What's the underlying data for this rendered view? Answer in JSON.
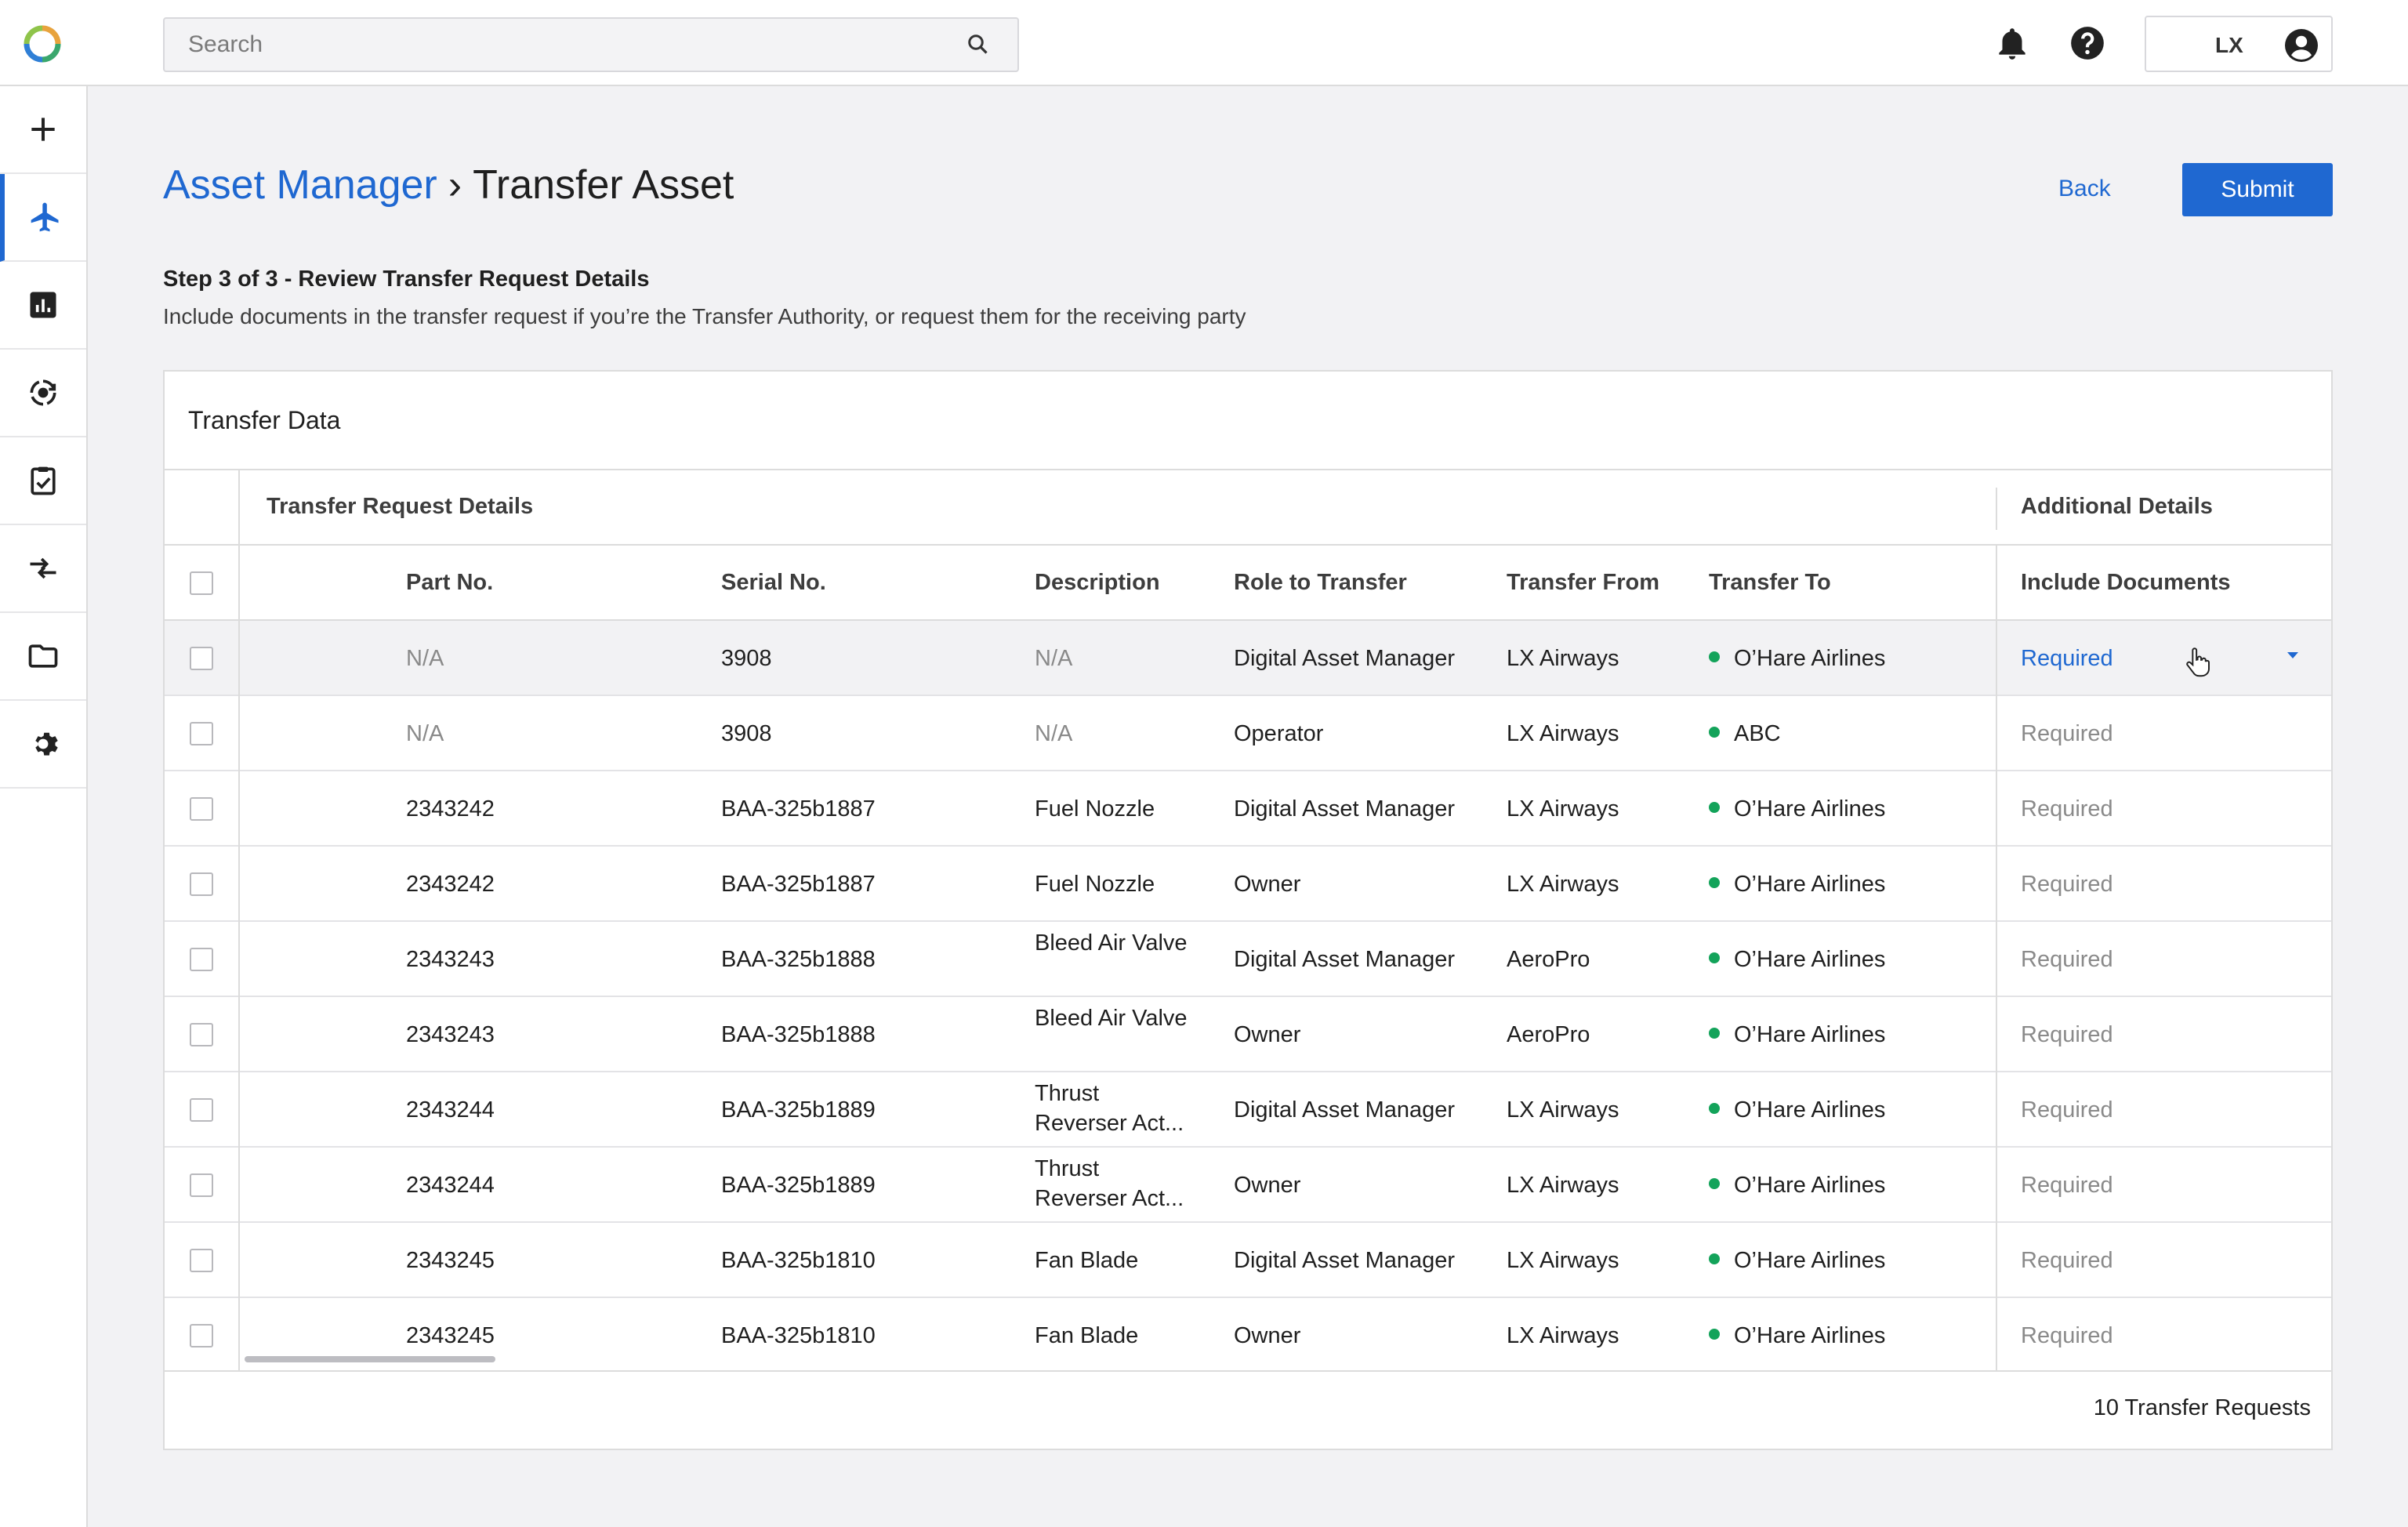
{
  "topbar": {
    "search_placeholder": "Search",
    "icons": [
      "app-logo-icon",
      "search-icon",
      "bell-icon",
      "help-icon",
      "account-icon"
    ],
    "user_initials": "LX"
  },
  "sidebar": {
    "items": [
      {
        "icon": "plus-icon",
        "active": false
      },
      {
        "icon": "airplane-icon",
        "active": true
      },
      {
        "icon": "bar-chart-icon",
        "active": false
      },
      {
        "icon": "sync-icon",
        "active": false
      },
      {
        "icon": "clipboard-check-icon",
        "active": false
      },
      {
        "icon": "transfer-arrows-icon",
        "active": false
      },
      {
        "icon": "folder-icon",
        "active": false
      },
      {
        "icon": "gear-icon",
        "active": false
      }
    ]
  },
  "header": {
    "breadcrumb_parent": "Asset Manager",
    "breadcrumb_sep": "›",
    "breadcrumb_current": "Transfer Asset",
    "back_label": "Back",
    "submit_label": "Submit",
    "step_title": "Step 3 of 3 - Review Transfer Request Details",
    "step_desc": "Include documents in the transfer request if you’re the Transfer Authority, or request them for the receiving party"
  },
  "table": {
    "card_title": "Transfer Data",
    "group1": "Transfer Request Details",
    "group2": "Additional Details",
    "columns": {
      "part": "Part No.",
      "serial": "Serial No.",
      "desc": "Description",
      "role": "Role to Transfer",
      "from": "Transfer From",
      "to": "Transfer To",
      "docs": "Include Documents"
    },
    "rows": [
      {
        "part": "N/A",
        "serial": "3908",
        "desc": "N/A",
        "role": "Digital Asset Manager",
        "from": "LX Airways",
        "to": "O’Hare Airlines",
        "docs": "Required"
      },
      {
        "part": "N/A",
        "serial": "3908",
        "desc": "N/A",
        "role": "Operator",
        "from": "LX Airways",
        "to": "ABC",
        "docs": "Required"
      },
      {
        "part": "2343242",
        "serial": "BAA-325b1887",
        "desc": "Fuel Nozzle",
        "role": "Digital Asset Manager",
        "from": "LX Airways",
        "to": "O’Hare Airlines",
        "docs": "Required"
      },
      {
        "part": "2343242",
        "serial": "BAA-325b1887",
        "desc": "Fuel Nozzle",
        "role": "Owner",
        "from": "LX Airways",
        "to": "O’Hare Airlines",
        "docs": "Required"
      },
      {
        "part": "2343243",
        "serial": "BAA-325b1888",
        "desc": "Bleed Air Valve",
        "role": "Digital Asset Manager",
        "from": "AeroPro",
        "to": "O’Hare Airlines",
        "docs": "Required"
      },
      {
        "part": "2343243",
        "serial": "BAA-325b1888",
        "desc": "Bleed Air Valve",
        "role": "Owner",
        "from": "AeroPro",
        "to": "O’Hare Airlines",
        "docs": "Required"
      },
      {
        "part": "2343244",
        "serial": "BAA-325b1889",
        "desc": "Thrust Reverser Act...",
        "role": "Digital Asset Manager",
        "from": "LX Airways",
        "to": "O’Hare Airlines",
        "docs": "Required"
      },
      {
        "part": "2343244",
        "serial": "BAA-325b1889",
        "desc": "Thrust Reverser Act...",
        "role": "Owner",
        "from": "LX Airways",
        "to": "O’Hare Airlines",
        "docs": "Required"
      },
      {
        "part": "2343245",
        "serial": "BAA-325b1810",
        "desc": "Fan Blade",
        "role": "Digital Asset Manager",
        "from": "LX Airways",
        "to": "O’Hare Airlines",
        "docs": "Required"
      },
      {
        "part": "2343245",
        "serial": "BAA-325b1810",
        "desc": "Fan Blade",
        "role": "Owner",
        "from": "LX Airways",
        "to": "O’Hare Airlines",
        "docs": "Required"
      }
    ],
    "footer_count": "10 Transfer Requests"
  },
  "colors": {
    "accent": "#1f68d1",
    "status_green": "#13a35a"
  }
}
